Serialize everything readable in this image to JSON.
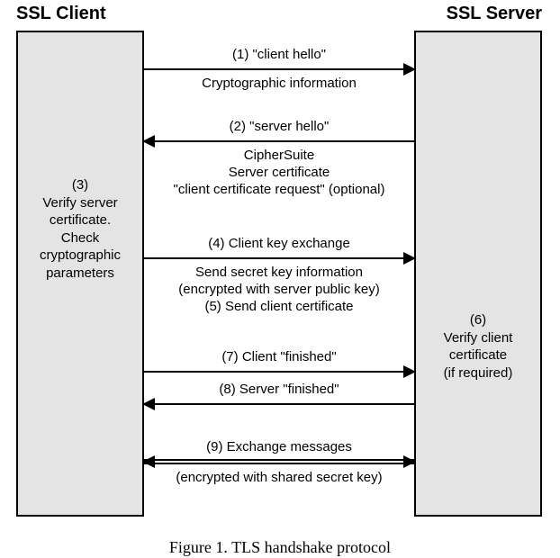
{
  "headers": {
    "client": "SSL Client",
    "server": "SSL Server"
  },
  "client_note": "(3)\nVerify server certificate.\nCheck cryptographic parameters",
  "server_note": "(6)\nVerify client certificate\n(if required)",
  "msgs": {
    "m1_label": "(1) \"client hello\"",
    "m1_sub": "Cryptographic information",
    "m2_label": "(2) \"server hello\"",
    "m2_sub": "CipherSuite\nServer certificate\n\"client certificate request\" (optional)",
    "m4_label": "(4) Client key exchange",
    "m4_sub": "Send secret key information\n(encrypted with server public key)\n(5) Send client certificate",
    "m7_label": "(7) Client \"finished\"",
    "m8_label": "(8) Server \"finished\"",
    "m9_label": "(9) Exchange messages",
    "m9_sub": "(encrypted with shared secret key)"
  },
  "caption": "Figure 1. TLS handshake protocol"
}
